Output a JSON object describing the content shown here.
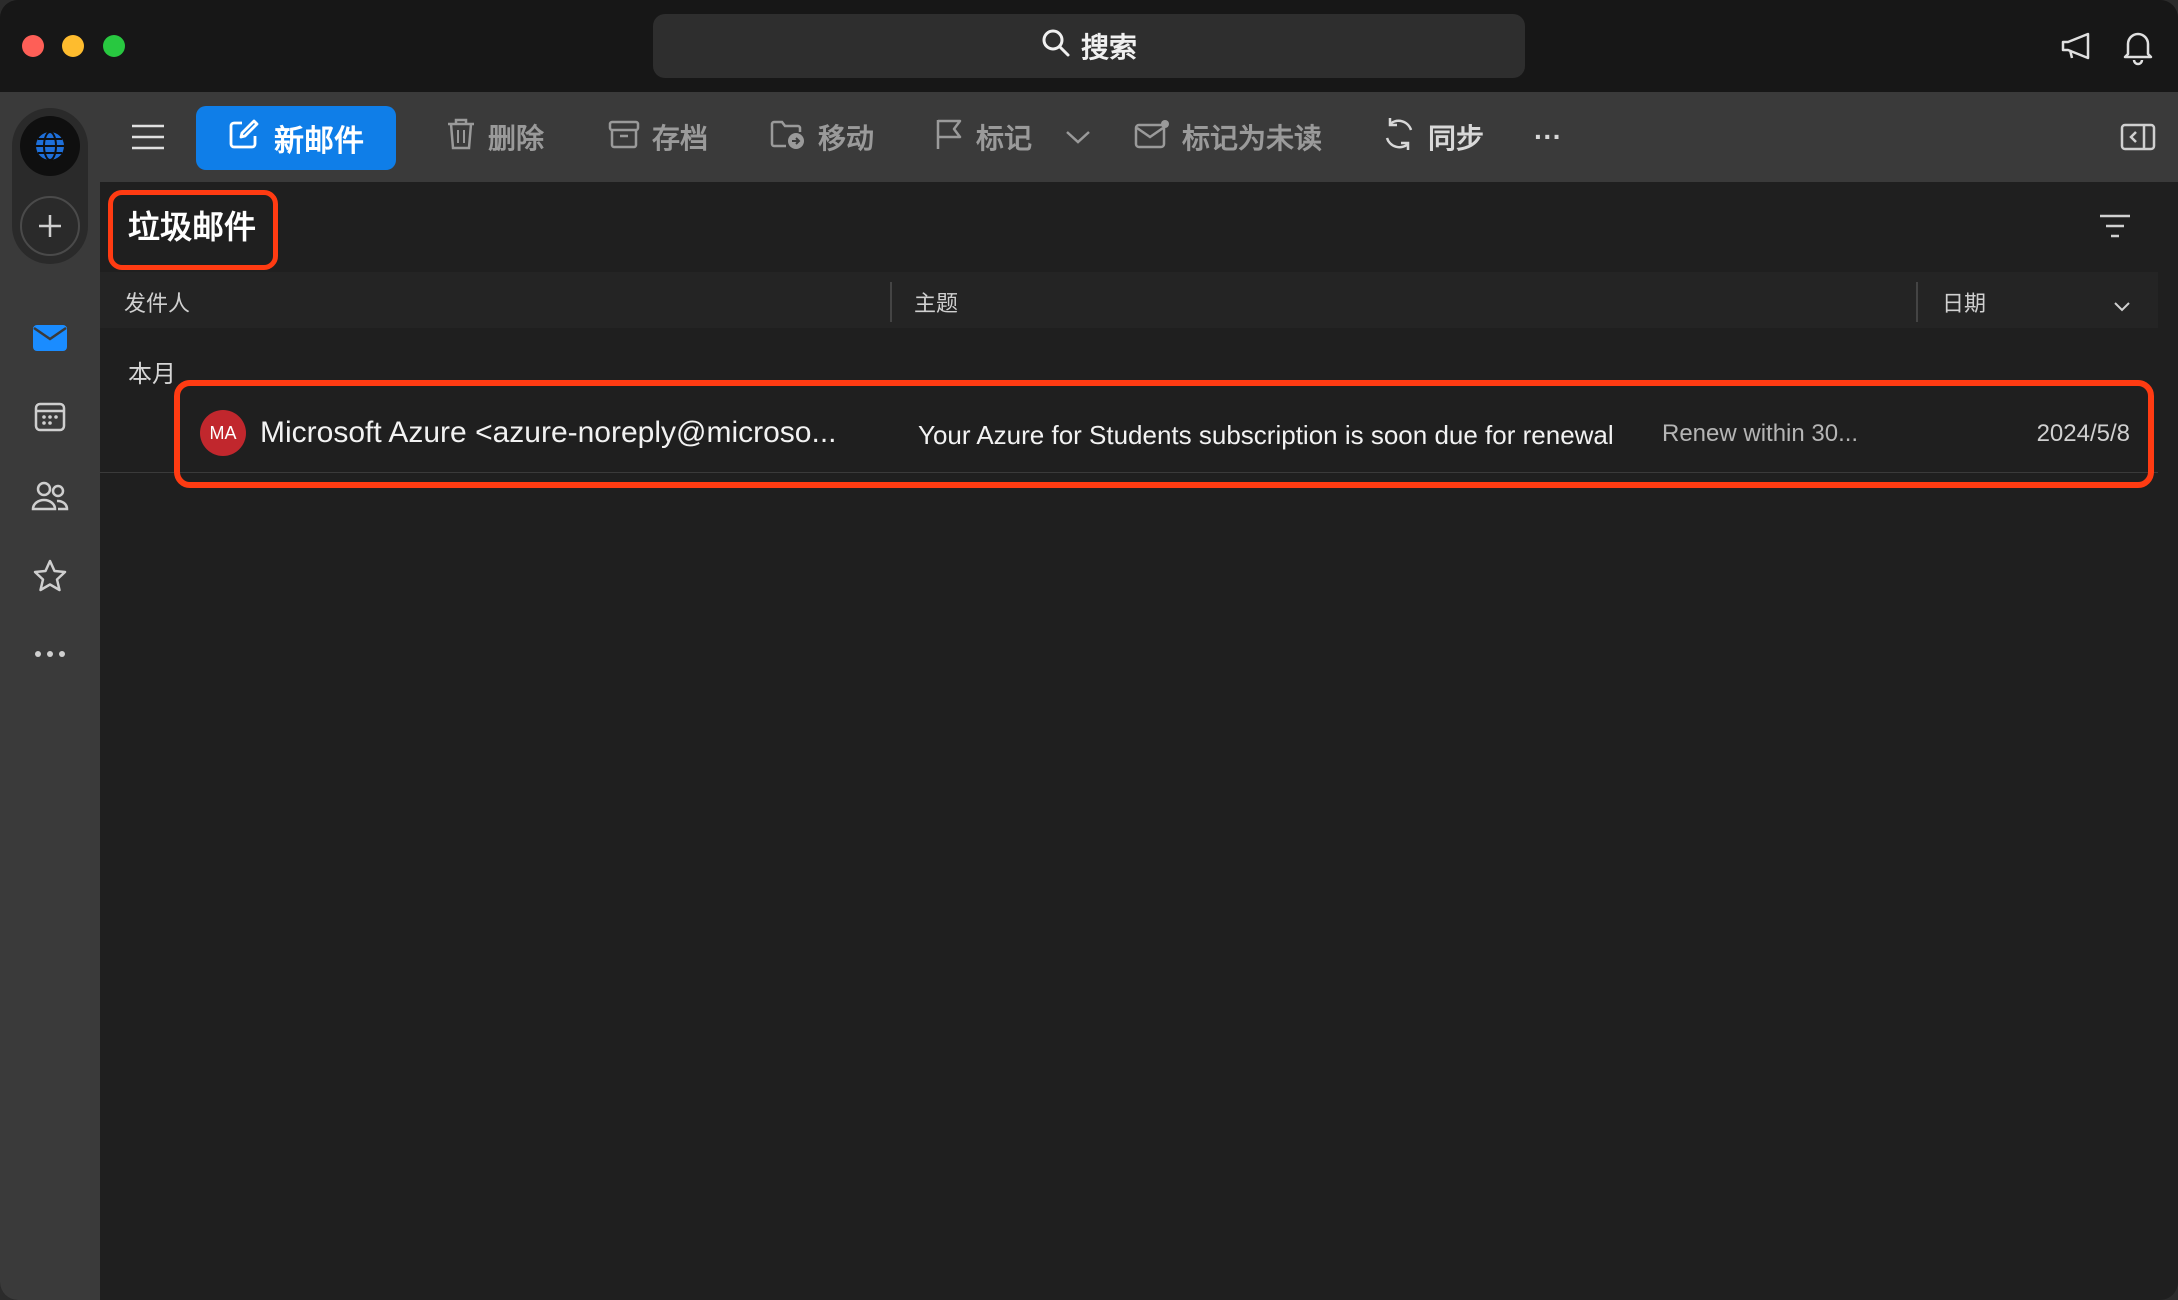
{
  "search": {
    "placeholder": "搜索"
  },
  "toolbar": {
    "new_mail": "新邮件",
    "delete": "删除",
    "archive": "存档",
    "move": "移动",
    "flag": "标记",
    "mark_unread": "标记为未读",
    "sync": "同步",
    "more": "···"
  },
  "folder": {
    "title": "垃圾邮件"
  },
  "columns": {
    "sender": "发件人",
    "subject": "主题",
    "date": "日期"
  },
  "group": {
    "label": "本月"
  },
  "messages": [
    {
      "avatar": "MA",
      "sender": "Microsoft Azure <azure-noreply@microso...",
      "subject": "Your Azure for Students subscription is soon due for renewal",
      "preview": "Renew within 30...",
      "date": "2024/5/8"
    }
  ],
  "colors": {
    "accent": "#0f7ee8",
    "highlight": "#ff3b12",
    "avatar": "#c1272d"
  }
}
